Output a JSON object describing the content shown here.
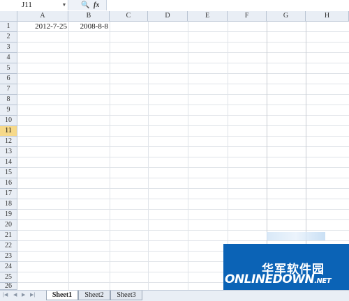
{
  "formula_bar": {
    "name_box": "J11",
    "zoom_icon": "zoom-icon",
    "fx_icon": "function-icon",
    "formula": ""
  },
  "columns": [
    "A",
    "B",
    "C",
    "D",
    "E",
    "F",
    "G",
    "H"
  ],
  "rows": [
    "1",
    "2",
    "3",
    "4",
    "5",
    "6",
    "7",
    "8",
    "9",
    "10",
    "11",
    "12",
    "13",
    "14",
    "15",
    "16",
    "17",
    "18",
    "19",
    "20",
    "21",
    "22",
    "23",
    "24",
    "25",
    "26"
  ],
  "active_row": "11",
  "cells": {
    "A1": "2012-7-25",
    "B1": "2008-8-8"
  },
  "sheets": [
    "Sheet1",
    "Sheet2",
    "Sheet3"
  ],
  "active_sheet": "Sheet1",
  "watermark": {
    "title": "华军软件园",
    "brand": "ONLINEDOWN",
    "suffix": ".NET",
    "color": "#0b63b6"
  }
}
